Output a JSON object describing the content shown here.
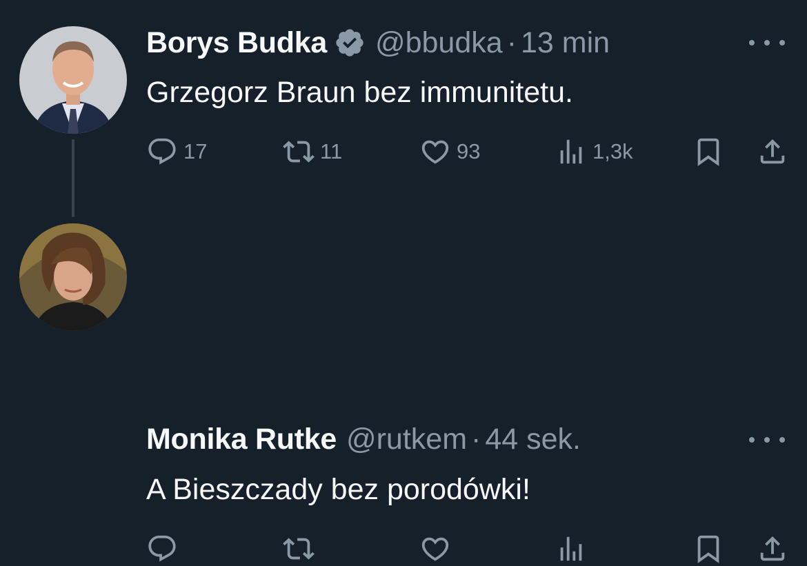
{
  "tweets": [
    {
      "author_name": "Borys Budka",
      "verified": true,
      "handle": "@bbudka",
      "separator": "·",
      "time": "13 min",
      "text": "Grzegorz Braun bez immunitetu.",
      "replies": "17",
      "retweets": "11",
      "likes": "93",
      "views": "1,3k"
    },
    {
      "author_name": "Monika Rutke",
      "verified": false,
      "handle": "@rutkem",
      "separator": "·",
      "time": "44 sek.",
      "text": "A Bieszczady bez porodówki!",
      "replies": "",
      "retweets": "",
      "likes": "",
      "views": ""
    }
  ],
  "colors": {
    "background": "#15202b",
    "text": "#f7f9f9",
    "muted": "#8b98a5",
    "thread_line": "#38444d"
  },
  "icons": [
    "verified-badge-icon",
    "more-icon",
    "reply-icon",
    "retweet-icon",
    "like-icon",
    "views-icon",
    "bookmark-icon",
    "share-icon"
  ]
}
